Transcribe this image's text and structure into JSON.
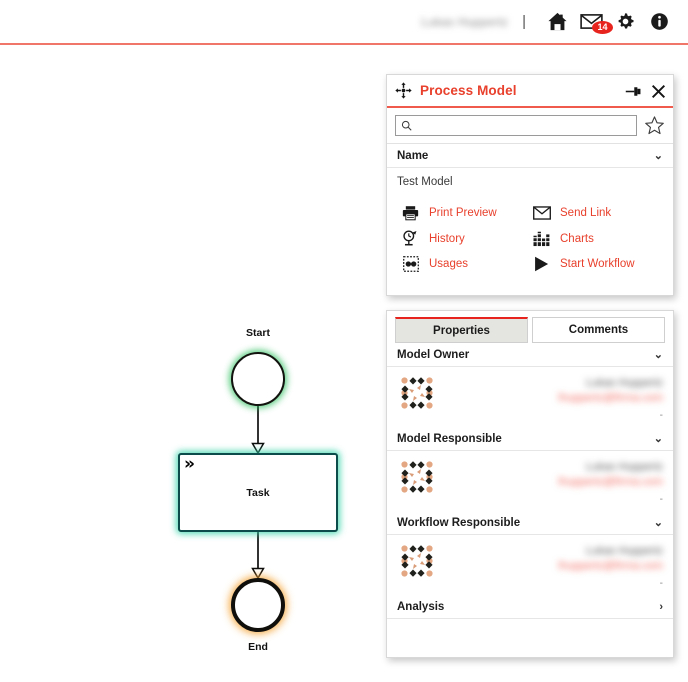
{
  "header": {
    "user_name": "Lukas Huppertz",
    "separator": "|",
    "icons": [
      {
        "name": "home-icon",
        "label": "Home"
      },
      {
        "name": "mail-icon",
        "label": "Messages",
        "badge": "14"
      },
      {
        "name": "gear-icon",
        "label": "Settings"
      },
      {
        "name": "info-icon",
        "label": "Info"
      }
    ]
  },
  "diagram": {
    "start_label": "Start",
    "task_label": "Task",
    "end_label": "End",
    "task_marker": "»",
    "colors": {
      "start_glow": "#28be5a",
      "task_glow": "#2dd2a5",
      "task_border": "#0c4c4a",
      "end_glow": "#f5a02d"
    }
  },
  "process_panel": {
    "title": "Process Model",
    "move_icon": "move-handle-icon",
    "pin_icon": "pin-icon",
    "close_icon": "close-icon",
    "search": {
      "value": "",
      "placeholder": "",
      "icon": "search-icon"
    },
    "favorite_icon": "star-icon",
    "name_section": {
      "label": "Name",
      "chevron": "⌄",
      "value": "Test Model"
    },
    "actions": [
      {
        "label": "Print Preview",
        "icon": "printer-icon"
      },
      {
        "label": "Send Link",
        "icon": "envelope-icon"
      },
      {
        "label": "History",
        "icon": "history-clock-icon"
      },
      {
        "label": "Charts",
        "icon": "bar-chart-icon"
      },
      {
        "label": "Usages",
        "icon": "usages-icon"
      },
      {
        "label": "Start Workflow",
        "icon": "play-icon"
      }
    ]
  },
  "details_panel": {
    "tabs": [
      {
        "label": "Properties",
        "active": true
      },
      {
        "label": "Comments",
        "active": false
      }
    ],
    "sections": [
      {
        "label": "Model Owner",
        "chevron": "⌄",
        "expanded": true,
        "person": {
          "avatar": "identicon-avatar",
          "name": "Lukas Huppertz",
          "email": "lhuppertz@firma.com",
          "extra": "-"
        }
      },
      {
        "label": "Model Responsible",
        "chevron": "⌄",
        "expanded": true,
        "person": {
          "avatar": "identicon-avatar",
          "name": "Lukas Huppertz",
          "email": "lhuppertz@firma.com",
          "extra": "-"
        }
      },
      {
        "label": "Workflow Responsible",
        "chevron": "⌄",
        "expanded": true,
        "person": {
          "avatar": "identicon-avatar",
          "name": "Lukas Huppertz",
          "email": "lhuppertz@firma.com",
          "extra": "-"
        }
      },
      {
        "label": "Analysis",
        "chevron": "›",
        "expanded": false,
        "person": null
      }
    ]
  },
  "theme": {
    "accent_red": "#e8402c",
    "header_rule": "#f1766a",
    "link_red": "#e8402c",
    "badge_red": "#e8241f"
  }
}
